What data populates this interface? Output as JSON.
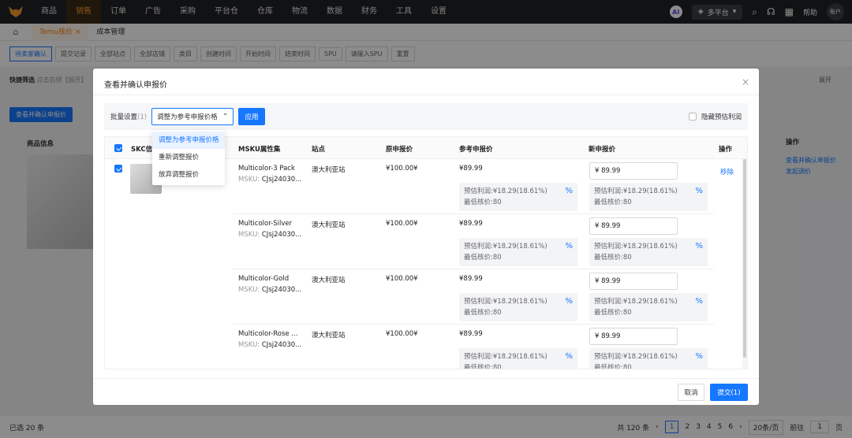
{
  "topnav": {
    "items": [
      "商品",
      "销售",
      "订单",
      "广告",
      "采购",
      "平台仓",
      "仓库",
      "物流",
      "数据",
      "财务",
      "工具",
      "设置"
    ],
    "active_index": 1,
    "ai_label": "AI",
    "platform_label": "多平台",
    "help_label": "帮助",
    "account_label": "账户"
  },
  "tabs": [
    {
      "label": "Temu核价",
      "active": true
    },
    {
      "label": "成本管理",
      "active": false
    }
  ],
  "filter": {
    "status_tabs": [
      "待卖家确认",
      "提交记录"
    ],
    "site_placeholder": "全部站点",
    "store_placeholder": "全部店铺",
    "category_placeholder": "类目",
    "time_label": "创建时间",
    "start_placeholder": "开始时间",
    "end_placeholder": "结束时间",
    "spu_label": "SPU",
    "spu_placeholder": "请输入SPU",
    "reset_label": "重置"
  },
  "quick_filter": {
    "label": "快捷筛选",
    "hint": "点击右侧【展开】"
  },
  "background": {
    "confirm_button": "查看并确认申报价",
    "product_info_header": "商品信息",
    "expand_label": "展开",
    "ops_header": "操作",
    "ops_links": [
      "查看并确认申报价",
      "发起调价"
    ],
    "selected_text": "已选 20 条",
    "total_text": "共 120 条",
    "pages": [
      "1",
      "2",
      "3",
      "4",
      "5",
      "6"
    ],
    "page_size": "20条/页",
    "goto_label": "前往",
    "goto_value": "1",
    "page_unit": "页"
  },
  "modal": {
    "title": "查看并确认申报价",
    "batch_label": "批量设置",
    "batch_count": "(1)",
    "batch_select_value": "调整为参考申报价格",
    "apply_label": "应用",
    "hide_profit_label": "隐藏预估利润",
    "dropdown_options": [
      "调整为参考申报价格",
      "重新调整报价",
      "放弃调整报价"
    ],
    "dropdown_selected_index": 0,
    "columns": [
      "SKC信",
      "MSKU属性集",
      "站点",
      "原申报价",
      "参考申报价",
      "新申报价",
      "操作"
    ],
    "rows": [
      {
        "msku": "Multicolor-3 Pack",
        "sku_label": "MSKU:",
        "sku_value": "CJsj24030...",
        "site": "澳大利亚站",
        "original_price": "¥100.00¥",
        "ref_price": "¥89.99",
        "ref_profit": "预估利润:¥18.29(18.61%)",
        "ref_min": "最低核价:80",
        "new_price": "¥ 89.99",
        "new_profit": "预估利润:¥18.29(18.61%)",
        "new_min": "最低核价:80"
      },
      {
        "msku": "Multicolor-Silver",
        "sku_label": "MSKU:",
        "sku_value": "CJsj24030...",
        "site": "澳大利亚站",
        "original_price": "¥100.00¥",
        "ref_price": "¥89.99",
        "ref_profit": "预估利润:¥18.29(18.61%)",
        "ref_min": "最低核价:80",
        "new_price": "¥ 89.99",
        "new_profit": "预估利润:¥18.29(18.61%)",
        "new_min": "最低核价:80"
      },
      {
        "msku": "Multicolor-Gold",
        "sku_label": "MSKU:",
        "sku_value": "CJsj24030...",
        "site": "澳大利亚站",
        "original_price": "¥100.00¥",
        "ref_price": "¥89.99",
        "ref_profit": "预估利润:¥18.29(18.61%)",
        "ref_min": "最低核价:80",
        "new_price": "¥ 89.99",
        "new_profit": "预估利润:¥18.29(18.61%)",
        "new_min": "最低核价:80"
      },
      {
        "msku": "Multicolor-Rose ...",
        "sku_label": "MSKU:",
        "sku_value": "CJsj24030...",
        "site": "澳大利亚站",
        "original_price": "¥100.00¥",
        "ref_price": "¥89.99",
        "ref_profit": "预估利润:¥18.29(18.61%)",
        "ref_min": "最低核价:80",
        "new_price": "¥ 89.99",
        "new_profit": "预估利润:¥18.29(18.61%)",
        "new_min": "最低核价:80"
      }
    ],
    "remove_label": "移除",
    "cancel_label": "取消",
    "submit_label": "提交(1)"
  }
}
